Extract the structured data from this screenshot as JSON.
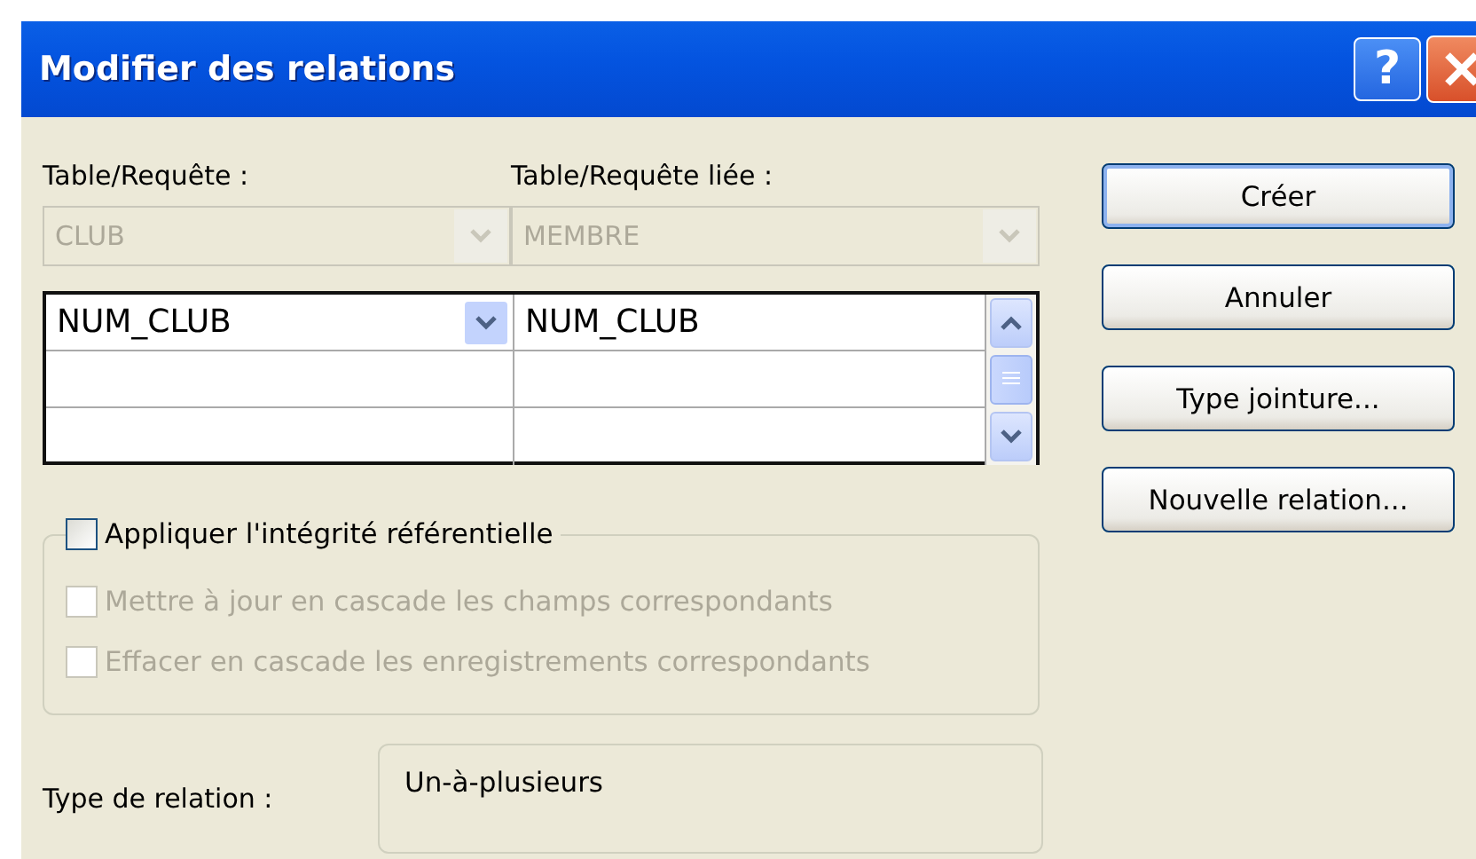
{
  "window": {
    "title": "Modifier des relations",
    "help_button": "?"
  },
  "combos": [
    {
      "label": "Table/Requête :",
      "value": "CLUB",
      "disabled": true
    },
    {
      "label": "Table/Requête liée :",
      "value": "MEMBRE",
      "disabled": true
    }
  ],
  "field_grid": {
    "rows": [
      {
        "column_1": "NUM_CLUB",
        "column_2": "NUM_CLUB"
      }
    ]
  },
  "checkboxes": [
    {
      "kind": "group",
      "label": "Appliquer l'intégrité référentielle",
      "checked": false,
      "disabled": false
    },
    {
      "kind": "option",
      "label": "Mettre à jour en cascade les champs correspondants",
      "checked": false,
      "disabled": true
    },
    {
      "kind": "option",
      "label": "Effacer en cascade les enregistrements correspondants",
      "checked": false,
      "disabled": true
    }
  ],
  "relation_type": {
    "label": "Type de relation :",
    "value": "Un-à-plusieurs"
  },
  "buttons": [
    {
      "label": "Créer",
      "default": true
    },
    {
      "label": "Annuler",
      "default": false
    },
    {
      "label": "Type jointure...",
      "default": false
    },
    {
      "label": "Nouvelle relation...",
      "default": false
    }
  ]
}
